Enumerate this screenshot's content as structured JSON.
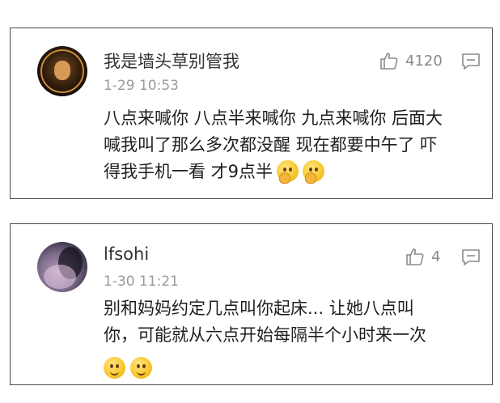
{
  "comments": [
    {
      "username": "我是墙头草别管我",
      "timestamp": "1-29 10:53",
      "likes": "4120",
      "content_lines": [
        "八点来喊你 八点半来喊你 九点来喊你 后面大",
        "喊我叫了那么多次都没醒 现在都要中午了 吓",
        "得我手机一看 才9点半"
      ],
      "emoji": [
        "thinking-face-emoji",
        "thinking-face-emoji"
      ]
    },
    {
      "username": "lfsohi",
      "timestamp": "1-30 11:21",
      "likes": "4",
      "content_lines": [
        "别和妈妈约定几点叫你起床... 让她八点叫",
        "你，可能就从六点开始每隔半个小时来一次"
      ],
      "emoji": [
        "smile-face-emoji",
        "smile-face-emoji"
      ]
    }
  ],
  "colors": {
    "username": "#333333",
    "timestamp": "#9a9a9a",
    "icon_gray": "#8a8a8a",
    "card_border": "#4a4a4a"
  }
}
